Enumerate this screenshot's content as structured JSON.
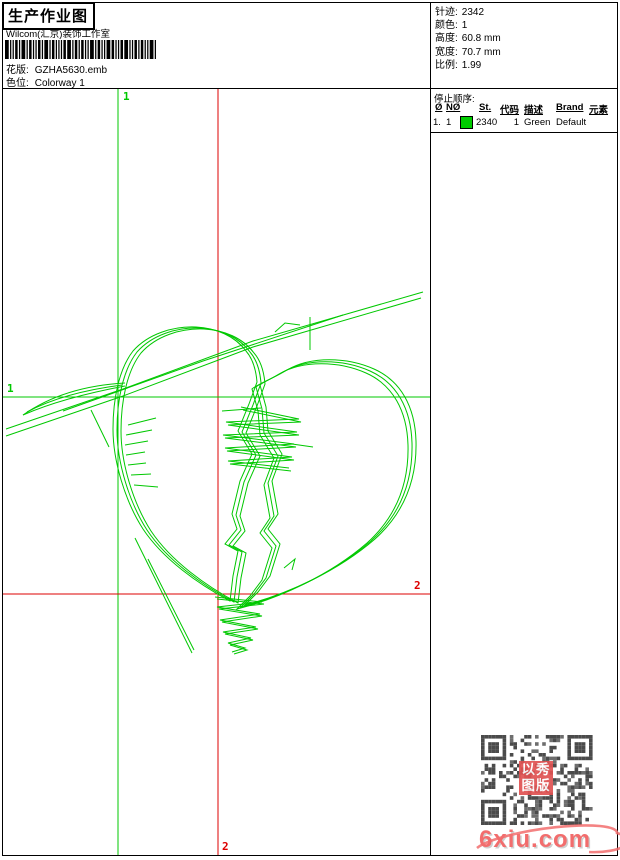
{
  "header": {
    "title": "生产作业图",
    "studio": "Wilcom(汇京)装饰工作室",
    "pattern": {
      "label": "花版:",
      "value": "GZHA5630.emb"
    },
    "colorway": {
      "label": "色位:",
      "value": "Colorway 1"
    }
  },
  "info": {
    "rows": [
      {
        "label": "针迹:",
        "value": "2342"
      },
      {
        "label": "颜色:",
        "value": "1"
      },
      {
        "label": "高度:",
        "value": "60.8 mm"
      },
      {
        "label": "宽度:",
        "value": "70.7 mm"
      },
      {
        "label": "比例:",
        "value": "1.99"
      }
    ]
  },
  "stop_sequence": {
    "title": "停止顺序:",
    "columns": [
      "Ø",
      "NØ",
      "St.",
      "代码",
      "描述",
      "Brand",
      "元素"
    ],
    "row": {
      "index": "1.",
      "needle": "1",
      "swatch_color": "#00cc00",
      "stitches": "2340",
      "code": "1",
      "description": "Green",
      "brand": "Default",
      "elements": ""
    }
  },
  "design": {
    "markers": {
      "needle1_top": "1",
      "needle1_left": "1",
      "needle2_right": "2",
      "needle2_bottom": "2"
    },
    "colors": {
      "thread_green": "#00c800",
      "marker_red": "#dd0000"
    }
  },
  "watermark": {
    "text": "6xiu.com",
    "color": "#f26d6d",
    "seal_text": "以秀图版"
  }
}
